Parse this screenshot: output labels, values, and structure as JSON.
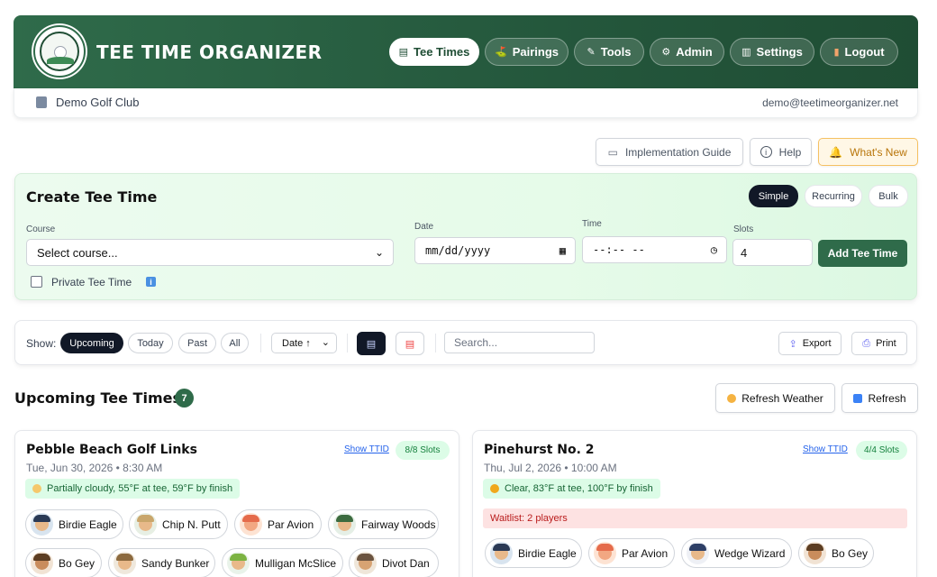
{
  "app": {
    "brand": "TEE TIME ORGANIZER",
    "logo_text": "TEE TIME ORGANIZER",
    "nav": [
      {
        "label": "Tee Times",
        "icon": "calendar-icon",
        "active": true
      },
      {
        "label": "Pairings",
        "icon": "golf-flag-icon"
      },
      {
        "label": "Tools",
        "icon": "tools-icon"
      },
      {
        "label": "Admin",
        "icon": "gear-icon"
      },
      {
        "label": "Settings",
        "icon": "building-icon"
      },
      {
        "label": "Logout",
        "icon": "door-icon"
      }
    ],
    "club_name": "Demo Golf Club",
    "email": "demo@teetimeorganizer.net",
    "colors": {
      "brand_green": "#2f6b4a",
      "accent_dark": "#111827",
      "link_blue": "#2563eb"
    }
  },
  "top_actions": {
    "guide": "Implementation Guide",
    "help": "Help",
    "whats_new": "What's New"
  },
  "create": {
    "title": "Create Tee Time",
    "modes": [
      "Simple",
      "Recurring",
      "Bulk"
    ],
    "active_mode": "Simple",
    "course_label": "Course",
    "course_value": "Select course...",
    "date_label": "Date",
    "date_value": "mm/dd/yyyy",
    "time_label": "Time",
    "time_value": "--:-- --",
    "slots_label": "Slots",
    "slots_value": "4",
    "add_button": "Add Tee Time",
    "private_label": "Private Tee Time"
  },
  "filters": {
    "show_label": "Show:",
    "options": [
      "Upcoming",
      "Today",
      "Past",
      "All"
    ],
    "active": "Upcoming",
    "sort_value": "Date ↑",
    "search_placeholder": "Search...",
    "export": "Export",
    "print": "Print"
  },
  "section": {
    "title": "Upcoming Tee Times",
    "count": "7",
    "refresh_weather": "Refresh Weather",
    "refresh": "Refresh"
  },
  "cards": [
    {
      "course": "Pebble Beach Golf Links",
      "datetime": "Tue, Jun 30, 2026 • 8:30 AM",
      "ttid": "Show TTID",
      "slots": "8/8 Slots",
      "weather": "Partially cloudy, 55°F at tee, 59°F by finish",
      "players": [
        "Birdie Eagle",
        "Chip N. Putt",
        "Par Avion",
        "Fairway Woods",
        "Bo Gey",
        "Sandy Bunker",
        "Mulligan McSlice",
        "Divot Dan"
      ]
    },
    {
      "course": "Pinehurst No. 2",
      "datetime": "Thu, Jul 2, 2026 • 10:00 AM",
      "ttid": "Show TTID",
      "slots": "4/4 Slots",
      "weather": "Clear, 83°F at tee, 100°F by finish",
      "waitlist": "Waitlist: 2 players",
      "players": [
        "Birdie Eagle",
        "Par Avion",
        "Wedge Wizard",
        "Bo Gey"
      ]
    }
  ]
}
